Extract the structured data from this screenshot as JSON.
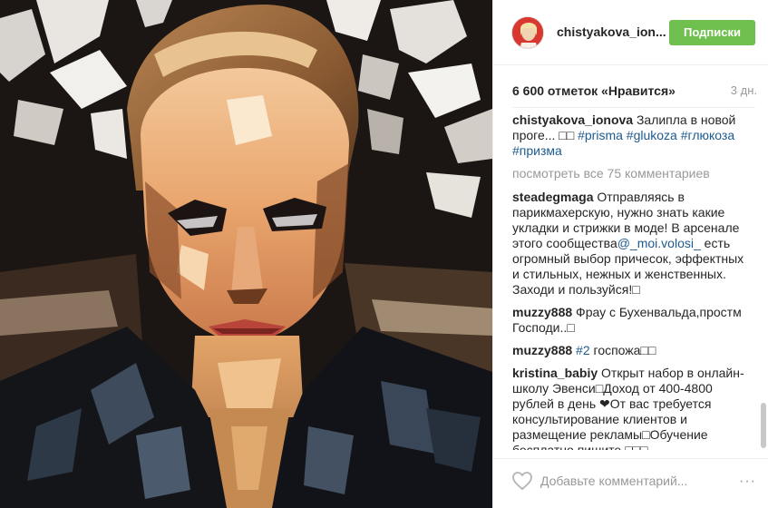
{
  "post": {
    "username": "chistyakova_ion...",
    "follow_label": "Подписки",
    "likes": "6 600 отметок «Нравится»",
    "age": "3 дн.",
    "caption_user": "chistyakova_ionova",
    "caption_text": " Залипла в новой проге... ",
    "caption_emoji": "□□ ",
    "caption_tags": [
      "#prisma",
      "#glukoza",
      "#глюкоза",
      "#призма"
    ],
    "view_all": "посмотреть все 75 комментариев"
  },
  "comments": [
    {
      "user": "steadegmaga",
      "text1": " Отправляясь в парикмахерскую, нужно знать какие укладки и стрижки в моде! В арсенале этого сообщества",
      "mention": "@_moi.volosi_",
      "text2": " есть огромный выбор причесок, эффектных и стильных, нежных и женственных. Заходи и пользуйся!□"
    },
    {
      "user": "muzzy888",
      "text1": " Фрау с Бухенвальда,простм Господи..□",
      "mention": "",
      "text2": ""
    },
    {
      "user": "muzzy888",
      "text1": " ",
      "mention": "#2",
      "text2": " госпожа□□"
    },
    {
      "user": "kristina_babiy",
      "text1": " Открыт набор в онлайн-школу Эвенси□Доход от 400-4800 рублей в день ❤От вас требуется консультирование клиентов и размещение рекламы□Обучение бесплатно,пишите □□□",
      "mention": "",
      "text2": ""
    }
  ],
  "footer": {
    "add_comment_placeholder": "Добавьте комментарий...",
    "more_label": "···"
  },
  "colors": {
    "follow_green": "#70c050",
    "tag_blue": "#1d5a8f",
    "muted": "#999999",
    "avatar_red": "#d8382f"
  },
  "icons": [
    "heart-icon",
    "more-options-icon"
  ]
}
